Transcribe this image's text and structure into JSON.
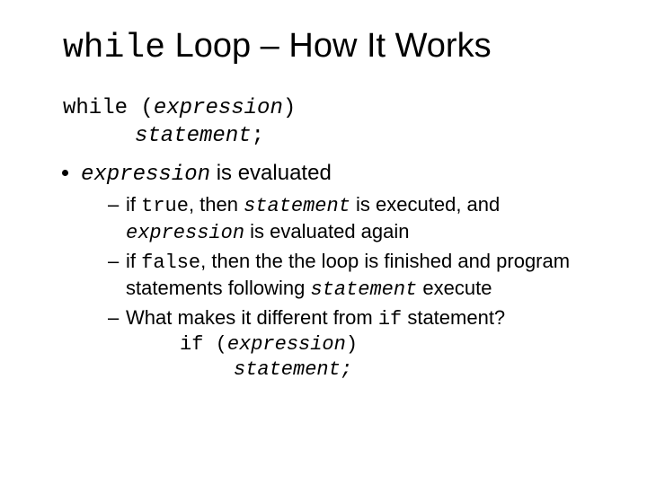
{
  "title": {
    "code": "while",
    "rest": " Loop – How It Works"
  },
  "syntax": {
    "line1_a": "while (",
    "line1_b": "expression",
    "line1_c": ")",
    "line2_a": "statement",
    "line2_b": ";"
  },
  "bullet1": {
    "code": "expression",
    "rest": " is evaluated"
  },
  "sub1": {
    "a": "if ",
    "true": "true",
    "b": ", then ",
    "stmt": "statement",
    "c": " is executed, and ",
    "expr": "expression",
    "d": " is evaluated again"
  },
  "sub2": {
    "a": "if ",
    "false": "false",
    "b": ", then the the loop is finished and program statements following ",
    "stmt": "statement",
    "c": " execute"
  },
  "sub3": {
    "a": "What makes it different from ",
    "if": "if",
    "b": " statement?"
  },
  "ifblock": {
    "line1_a": "if (",
    "line1_b": "expression",
    "line1_c": ")",
    "line2_a": "statement;"
  }
}
